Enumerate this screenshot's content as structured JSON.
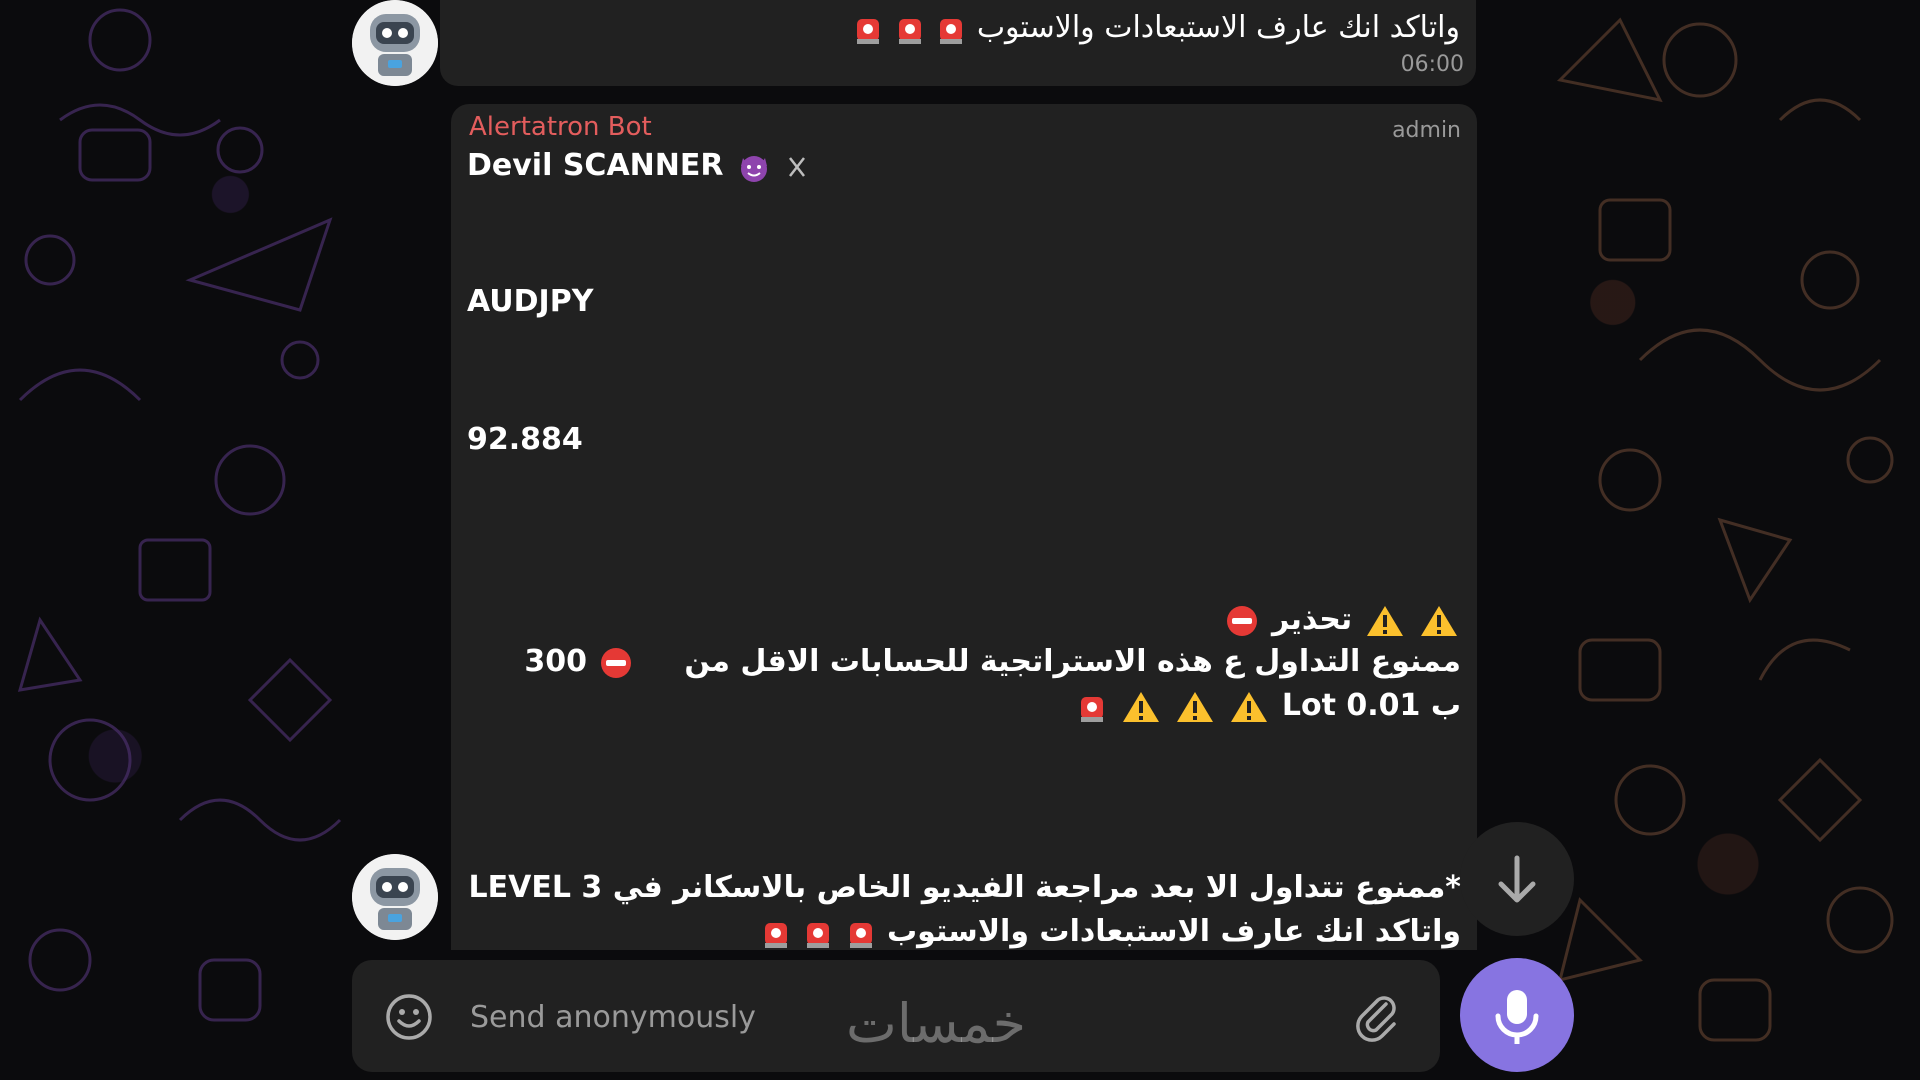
{
  "colors": {
    "bubble_bg": "#212121",
    "bot_name": "#e35d5d",
    "accent": "#8774e1",
    "meta_text": "#9a9a9a",
    "text": "#ffffff"
  },
  "previous_message": {
    "text": "واتاكد انك عارف الاستبعادات والاستوب",
    "emoji": [
      "siren",
      "siren",
      "siren"
    ],
    "time": "06:00"
  },
  "message": {
    "sender": "Alertatron Bot",
    "role": "admin",
    "title": "Devil SCANNER",
    "title_emoji": [
      "smiling-imp",
      "crossed-swords"
    ],
    "symbol": "AUDJPY",
    "price": "92.884",
    "warning_title": "تحذير",
    "warning_line1": "ممنوع التداول ع هذه الاستراتجية للحسابات الاقل من",
    "warning_amount": "300",
    "warning_line2_prefix": "ب",
    "warning_lot": "Lot 0.01",
    "footer_line1": "*ممنوع تتداول الا بعد مراجعة الفيديو الخاص بالاسكانر في",
    "footer_level": "LEVEL 3",
    "footer_line2": "واتاكد انك عارف الاستبعادات والاستوب"
  },
  "composer": {
    "placeholder": "Send anonymously",
    "emoji_icon": "smiley-icon",
    "attach_icon": "paperclip-icon",
    "mic_icon": "microphone-icon"
  },
  "scroll_down_icon": "arrow-down-icon",
  "watermark": "خمسات"
}
